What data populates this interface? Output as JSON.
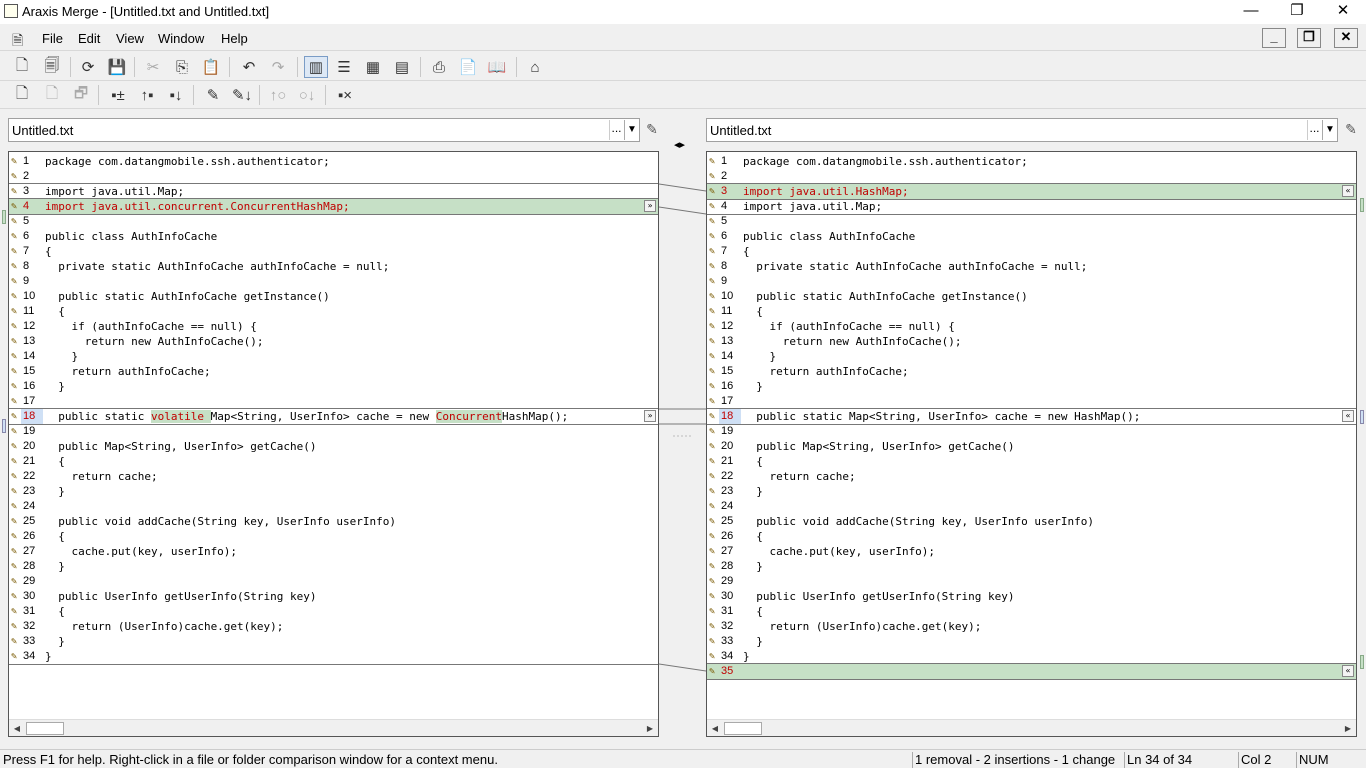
{
  "window": {
    "title": "Araxis Merge - [Untitled.txt and Untitled.txt]",
    "min_symbol": "—",
    "restore_symbol": "❐",
    "close_symbol": "✕"
  },
  "menu": {
    "items": [
      "File",
      "Edit",
      "View",
      "Window",
      "Help"
    ],
    "mdi_min": "_",
    "mdi_restore": "❐",
    "mdi_close": "✕"
  },
  "toolbar1": {
    "icons": [
      "new-document-icon",
      "new-folder-comparison-icon",
      "refresh-icon",
      "save-icon",
      "cut-icon",
      "copy-icon",
      "paste-icon",
      "undo-icon",
      "redo-icon",
      "two-way-view-icon",
      "horizontal-view-icon",
      "three-way-view-icon",
      "report-view-icon",
      "print-icon",
      "clipboard-icon",
      "book-icon",
      "home-icon"
    ]
  },
  "toolbar2": {
    "icons": [
      "page-icon",
      "page-disabled-icon",
      "page-merge-icon",
      "bookmark-add-icon",
      "bookmark-prev-icon",
      "bookmark-next-icon",
      "edit-pen-icon",
      "edit-pen-down-icon",
      "link-prev-icon",
      "link-next-icon",
      "clear-bookmarks-icon"
    ]
  },
  "left_file": {
    "path": "Untitled.txt",
    "browse": "..."
  },
  "right_file": {
    "path": "Untitled.txt",
    "browse": "..."
  },
  "center": {
    "swap_symbol": "◂▸"
  },
  "colors": {
    "insert_bg": "#c6e0c6",
    "change_text": "#c00000",
    "change_num_bg": "#cfe0f5"
  },
  "left_pane": {
    "lines": [
      {
        "n": "1",
        "code": "package com.datangmobile.ssh.authenticator;"
      },
      {
        "n": "2",
        "code": ""
      },
      {
        "n": "3",
        "code": "import java.util.Map;"
      },
      {
        "n": "4",
        "code": "import java.util.concurrent.ConcurrentHashMap;",
        "type": "diff"
      },
      {
        "n": "5",
        "code": ""
      },
      {
        "n": "6",
        "code": "public class AuthInfoCache"
      },
      {
        "n": "7",
        "code": "{"
      },
      {
        "n": "8",
        "code": "  private static AuthInfoCache authInfoCache = null;"
      },
      {
        "n": "9",
        "code": ""
      },
      {
        "n": "10",
        "code": "  public static AuthInfoCache getInstance()"
      },
      {
        "n": "11",
        "code": "  {"
      },
      {
        "n": "12",
        "code": "    if (authInfoCache == null) {"
      },
      {
        "n": "13",
        "code": "      return new AuthInfoCache();"
      },
      {
        "n": "14",
        "code": "    }"
      },
      {
        "n": "15",
        "code": "    return authInfoCache;"
      },
      {
        "n": "16",
        "code": "  }"
      },
      {
        "n": "17",
        "code": ""
      },
      {
        "n": "18",
        "type": "chg",
        "parts": [
          {
            "t": "  public static "
          },
          {
            "t": "volatile ",
            "hl": true
          },
          {
            "t": "Map<String, UserInfo> cache = new "
          },
          {
            "t": "Concurrent",
            "hl": true
          },
          {
            "t": "HashMap();"
          }
        ]
      },
      {
        "n": "19",
        "code": ""
      },
      {
        "n": "20",
        "code": "  public Map<String, UserInfo> getCache()"
      },
      {
        "n": "21",
        "code": "  {"
      },
      {
        "n": "22",
        "code": "    return cache;"
      },
      {
        "n": "23",
        "code": "  }"
      },
      {
        "n": "24",
        "code": ""
      },
      {
        "n": "25",
        "code": "  public void addCache(String key, UserInfo userInfo)"
      },
      {
        "n": "26",
        "code": "  {"
      },
      {
        "n": "27",
        "code": "    cache.put(key, userInfo);"
      },
      {
        "n": "28",
        "code": "  }"
      },
      {
        "n": "29",
        "code": ""
      },
      {
        "n": "30",
        "code": "  public UserInfo getUserInfo(String key)"
      },
      {
        "n": "31",
        "code": "  {"
      },
      {
        "n": "32",
        "code": "    return (UserInfo)cache.get(key);"
      },
      {
        "n": "33",
        "code": "  }"
      },
      {
        "n": "34",
        "code": "}"
      }
    ]
  },
  "right_pane": {
    "lines": [
      {
        "n": "1",
        "code": "package com.datangmobile.ssh.authenticator;"
      },
      {
        "n": "2",
        "code": ""
      },
      {
        "n": "3",
        "code": "import java.util.HashMap;",
        "type": "diff"
      },
      {
        "n": "4",
        "code": "import java.util.Map;"
      },
      {
        "n": "5",
        "code": ""
      },
      {
        "n": "6",
        "code": "public class AuthInfoCache"
      },
      {
        "n": "7",
        "code": "{"
      },
      {
        "n": "8",
        "code": "  private static AuthInfoCache authInfoCache = null;"
      },
      {
        "n": "9",
        "code": ""
      },
      {
        "n": "10",
        "code": "  public static AuthInfoCache getInstance()"
      },
      {
        "n": "11",
        "code": "  {"
      },
      {
        "n": "12",
        "code": "    if (authInfoCache == null) {"
      },
      {
        "n": "13",
        "code": "      return new AuthInfoCache();"
      },
      {
        "n": "14",
        "code": "    }"
      },
      {
        "n": "15",
        "code": "    return authInfoCache;"
      },
      {
        "n": "16",
        "code": "  }"
      },
      {
        "n": "17",
        "code": ""
      },
      {
        "n": "18",
        "code": "  public static Map<String, UserInfo> cache = new HashMap();",
        "type": "chg"
      },
      {
        "n": "19",
        "code": ""
      },
      {
        "n": "20",
        "code": "  public Map<String, UserInfo> getCache()"
      },
      {
        "n": "21",
        "code": "  {"
      },
      {
        "n": "22",
        "code": "    return cache;"
      },
      {
        "n": "23",
        "code": "  }"
      },
      {
        "n": "24",
        "code": ""
      },
      {
        "n": "25",
        "code": "  public void addCache(String key, UserInfo userInfo)"
      },
      {
        "n": "26",
        "code": "  {"
      },
      {
        "n": "27",
        "code": "    cache.put(key, userInfo);"
      },
      {
        "n": "28",
        "code": "  }"
      },
      {
        "n": "29",
        "code": ""
      },
      {
        "n": "30",
        "code": "  public UserInfo getUserInfo(String key)"
      },
      {
        "n": "31",
        "code": "  {"
      },
      {
        "n": "32",
        "code": "    return (UserInfo)cache.get(key);"
      },
      {
        "n": "33",
        "code": "  }"
      },
      {
        "n": "34",
        "code": "}"
      },
      {
        "n": "35",
        "code": "",
        "type": "diff"
      }
    ]
  },
  "status": {
    "help": "Press F1 for help. Right-click in a file or folder comparison window for a context menu.",
    "summary": "1 removal - 2 insertions - 1 change",
    "line": "Ln 34 of 34",
    "col": "Col 2",
    "num": "NUM"
  }
}
